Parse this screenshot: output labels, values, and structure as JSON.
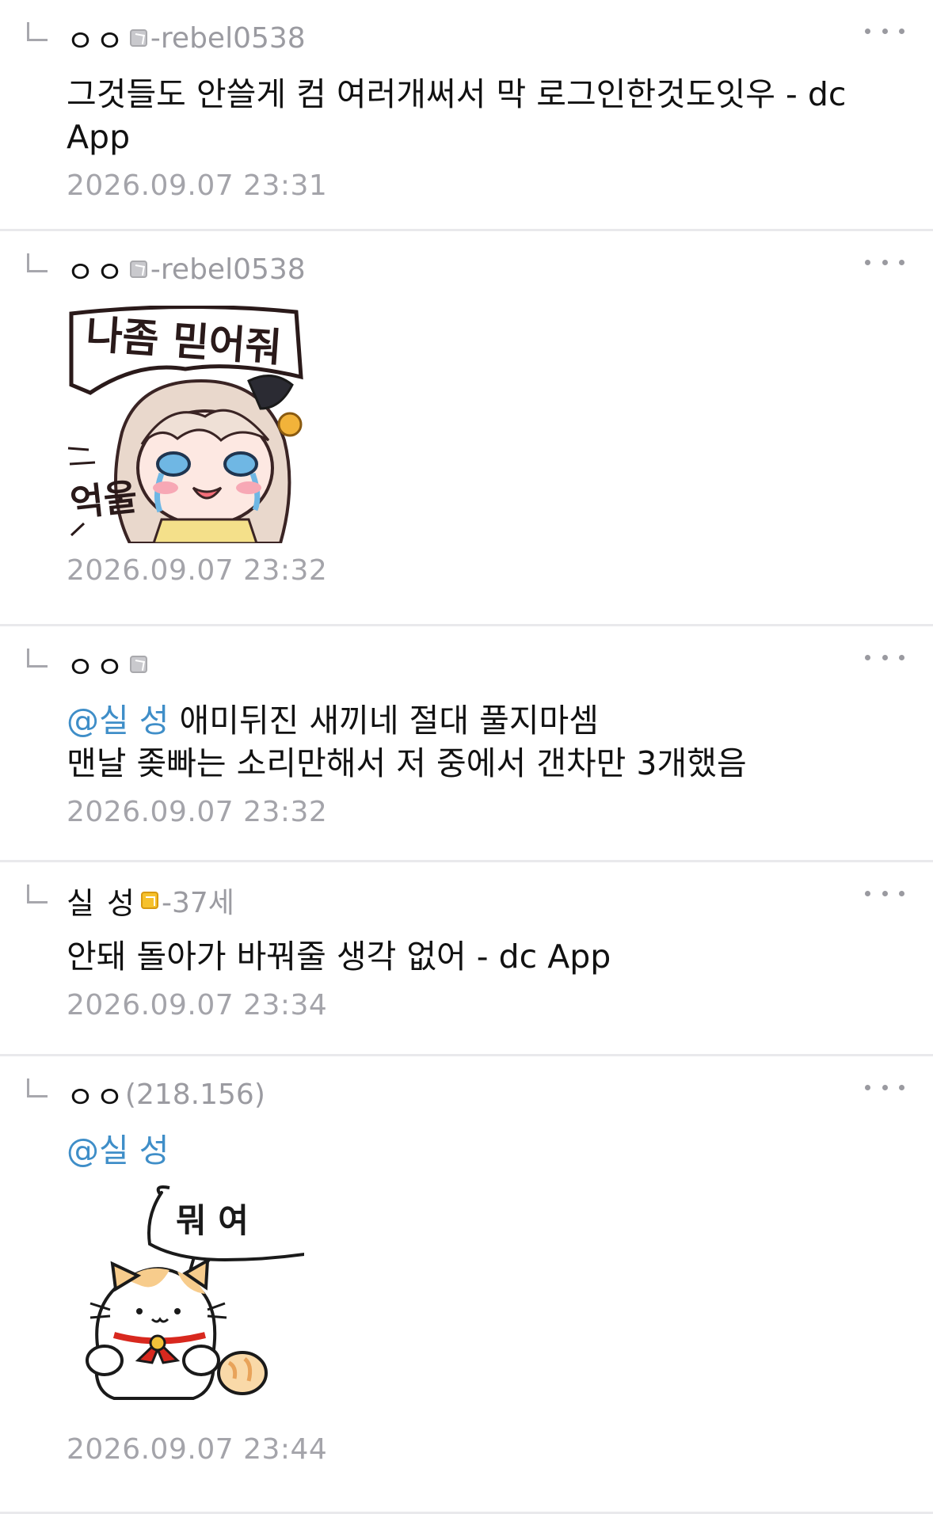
{
  "comments": [
    {
      "author": "ㅇㅇ",
      "author_meta": "-rebel0538",
      "text": "그것들도 안쓸게 컴 여러개써서 막 로그인한것도잇우 - dc App",
      "timestamp": "2026.09.07 23:31"
    },
    {
      "author": "ㅇㅇ",
      "author_meta": "-rebel0538",
      "sticker_text_top": "나좀 믿어줘",
      "sticker_text_side": "억울",
      "timestamp": "2026.09.07 23:32"
    },
    {
      "author": "ㅇㅇ",
      "mention": "@실 성",
      "text_line1": " 애미뒤진 새끼네 절대 풀지마셈",
      "text_line2": "맨날 좆빠는 소리만해서 저 중에서 갠차만 3개했음",
      "timestamp": "2026.09.07 23:32"
    },
    {
      "author": "실 성",
      "author_meta": "-37세",
      "text": "안돼 돌아가 바꿔줄 생각 없어 - dc App",
      "timestamp": "2026.09.07 23:34"
    },
    {
      "author": "ㅇㅇ",
      "author_meta": "(218.156)",
      "mention": "@실 성",
      "sticker_text": "뭐 여",
      "timestamp": "2026.09.07 23:44"
    }
  ]
}
